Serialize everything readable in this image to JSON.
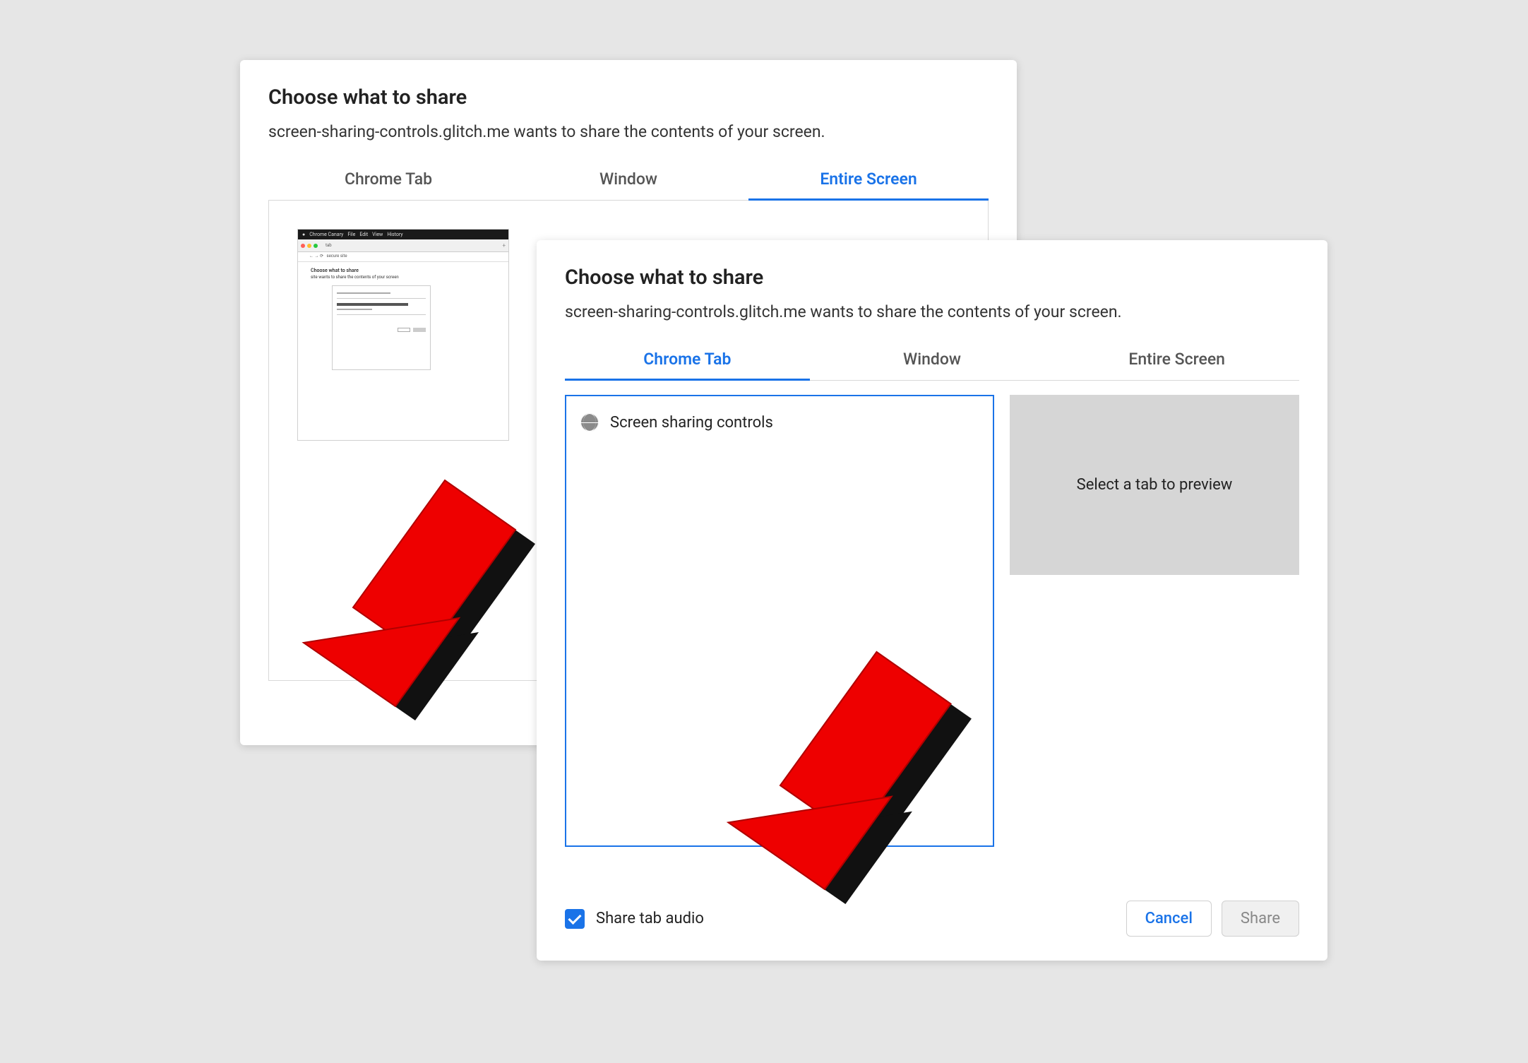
{
  "back_dialog": {
    "title": "Choose what to share",
    "subtitle": "screen-sharing-controls.glitch.me wants to share the contents of your screen.",
    "tabs": [
      {
        "label": "Chrome Tab",
        "active": false
      },
      {
        "label": "Window",
        "active": false
      },
      {
        "label": "Entire Screen",
        "active": true
      }
    ]
  },
  "front_dialog": {
    "title": "Choose what to share",
    "subtitle": "screen-sharing-controls.glitch.me wants to share the contents of your screen.",
    "tabs": [
      {
        "label": "Chrome Tab",
        "active": true
      },
      {
        "label": "Window",
        "active": false
      },
      {
        "label": "Entire Screen",
        "active": false
      }
    ],
    "tab_items": [
      {
        "label": "Screen sharing controls"
      }
    ],
    "preview_placeholder": "Select a tab to preview",
    "share_audio_label": "Share tab audio",
    "share_audio_checked": true,
    "cancel_label": "Cancel",
    "share_label": "Share"
  },
  "colors": {
    "accent": "#1a73e8",
    "arrow": "#ee0000"
  }
}
